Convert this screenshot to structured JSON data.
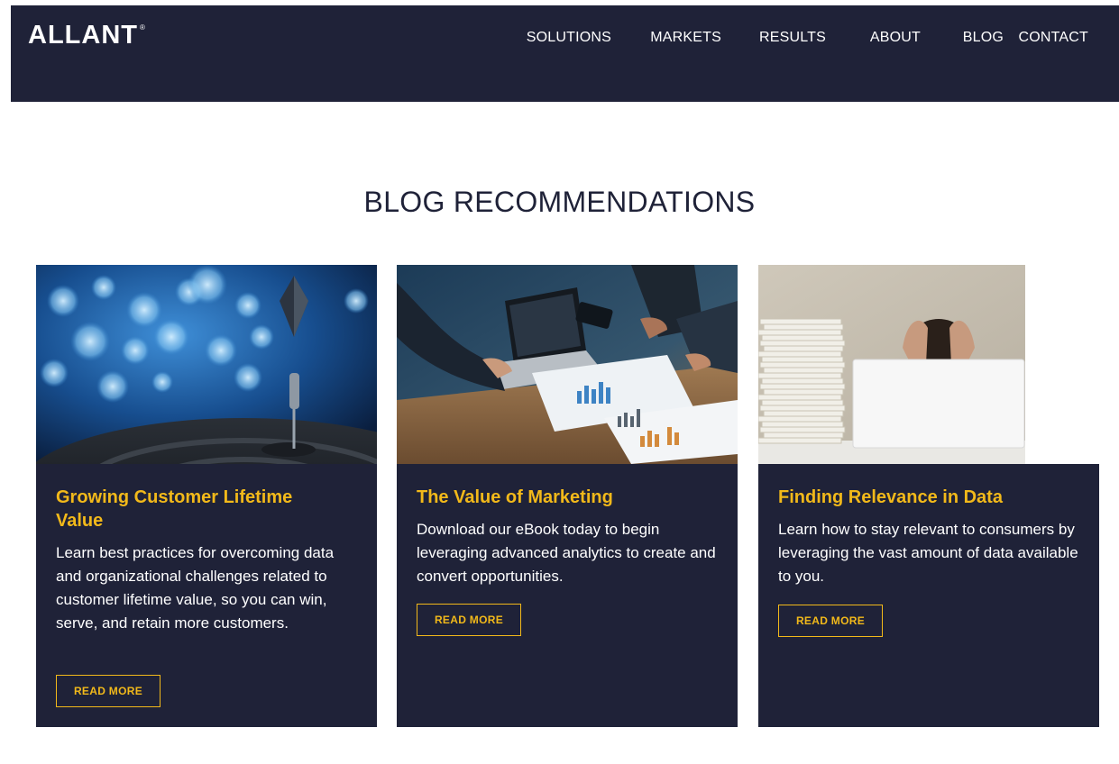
{
  "header": {
    "logo": "ALLANT",
    "logo_mark": "®",
    "nav": [
      "SOLUTIONS",
      "MARKETS",
      "RESULTS",
      "ABOUT",
      "BLOG",
      "CONTACT"
    ]
  },
  "section": {
    "title": "BLOG RECOMMENDATIONS"
  },
  "cards": [
    {
      "title": "Growing Customer Lifetime Value",
      "description": "Learn best practices for overcoming data and organizational challenges related to customer lifetime value, so you can win, serve, and retain more customers.",
      "button": "READ MORE",
      "image": "dartboard-bokeh-image"
    },
    {
      "title": "The Value of Marketing",
      "description": "Download our eBook today to begin leveraging advanced analytics to create and convert opportunities.",
      "button": "READ MORE",
      "image": "team-analytics-meeting-image"
    },
    {
      "title": "Finding Relevance in Data",
      "description": "Learn how to stay relevant to consumers by leveraging the vast amount of data available to you.",
      "button": "READ MORE",
      "image": "stressed-man-paper-stack-image"
    }
  ],
  "colors": {
    "navy": "#1f2238",
    "accent": "#f2b91a",
    "white": "#ffffff"
  }
}
